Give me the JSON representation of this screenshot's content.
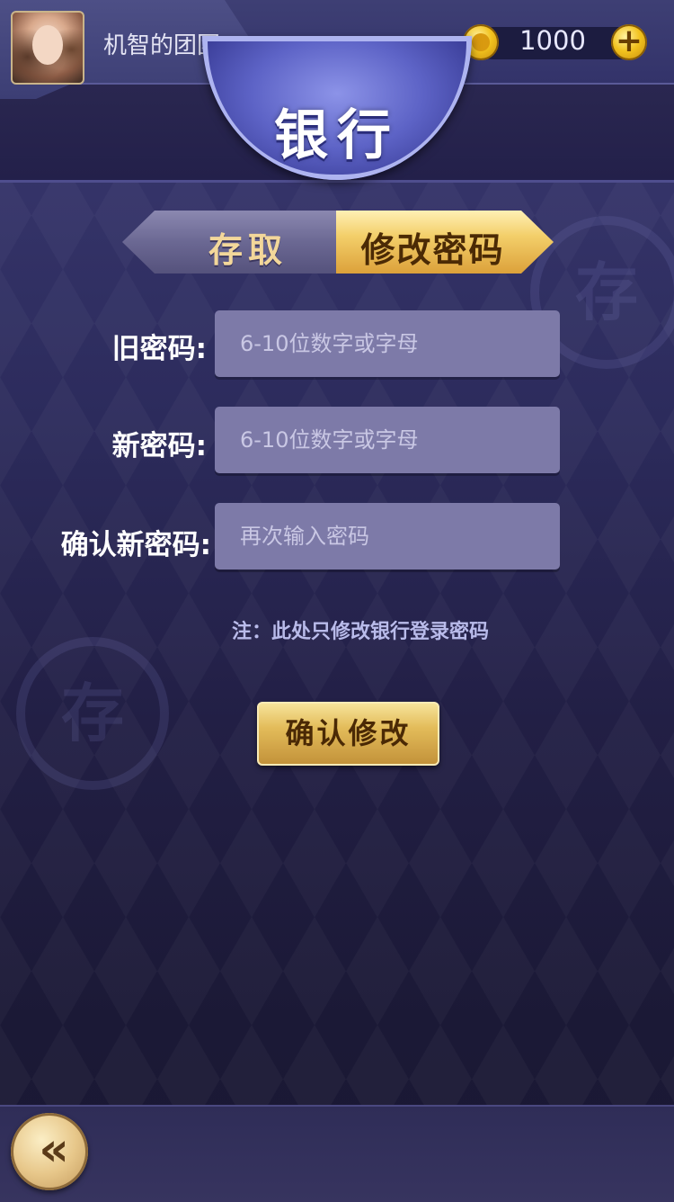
{
  "header": {
    "username": "机智的团团",
    "coins": "1000",
    "add_label": "+"
  },
  "title": "银行",
  "tabs": [
    {
      "label": "存取",
      "active": false
    },
    {
      "label": "修改密码",
      "active": true
    }
  ],
  "form": {
    "old_password": {
      "label": "旧密码:",
      "placeholder": "6-10位数字或字母"
    },
    "new_password": {
      "label": "新密码:",
      "placeholder": "6-10位数字或字母"
    },
    "confirm_password": {
      "label": "确认新密码:",
      "placeholder": "再次输入密码"
    },
    "note": "注：此处只修改银行登录密码",
    "confirm_label": "确认修改"
  },
  "watermark_text": "存",
  "back_label": "«",
  "colors": {
    "background": "#2c2b5c",
    "gold": "#e3bc5a",
    "field": "#7d7aa8",
    "note": "#b9bbea"
  }
}
